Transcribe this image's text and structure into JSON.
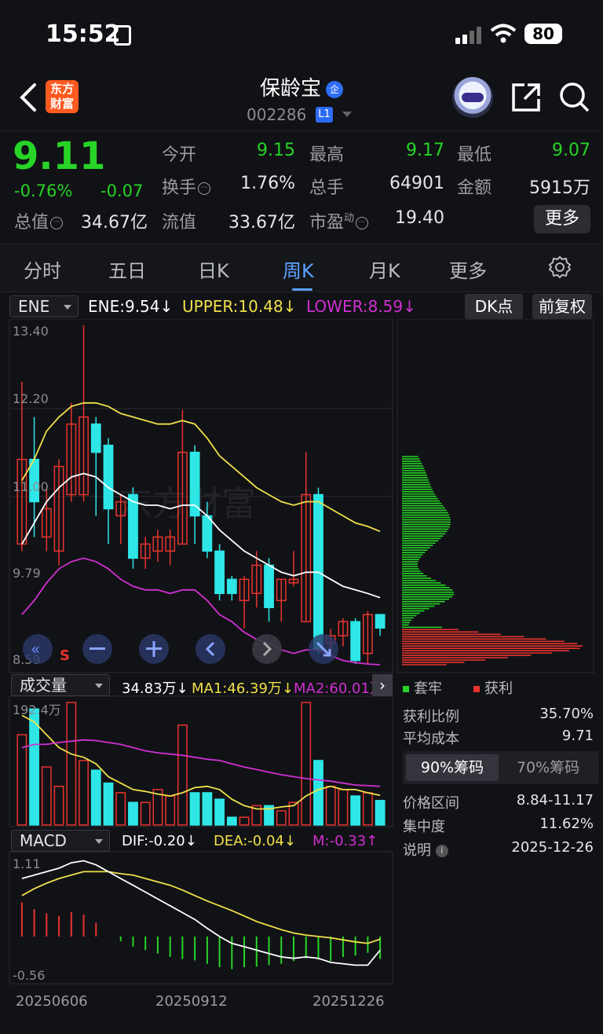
{
  "status": {
    "time": "15:52",
    "battery": "80"
  },
  "header": {
    "logo": "东方财富",
    "title": "保龄宝",
    "badge": "企",
    "code": "002286",
    "level": "L1"
  },
  "quote": {
    "price": "9.11",
    "pct": "-0.76%",
    "chg": "-0.07",
    "labels": {
      "open": "今开",
      "high": "最高",
      "low": "最低",
      "turnover": "换手",
      "volume": "总手",
      "amount": "金额",
      "mktcap": "总值",
      "float": "流值",
      "pe": "市盈",
      "pe_sup": "动"
    },
    "values": {
      "open": "9.15",
      "high": "9.17",
      "low": "9.07",
      "turnover": "1.76%",
      "volume": "64901",
      "amount": "5915万",
      "mktcap": "34.67亿",
      "float": "33.67亿",
      "pe": "19.40"
    },
    "more": "更多"
  },
  "tabs": [
    "分时",
    "五日",
    "日K",
    "周K",
    "月K",
    "更多"
  ],
  "ene": {
    "name": "ENE",
    "ene": "ENE:9.54↓",
    "upper": "UPPER:10.48↓",
    "lower": "LOWER:8.59↓",
    "dk": "DK点",
    "fq": "前复权"
  },
  "price_axis": [
    "13.40",
    "12.20",
    "11.00",
    "9.79",
    "8.59"
  ],
  "vol": {
    "name": "成交量",
    "val": "34.83万↓",
    "ma1": "MA1:46.39万↓",
    "ma2": "MA2:60.01万",
    "axis_top": "192.4万"
  },
  "macd": {
    "name": "MACD",
    "dif": "DIF:-0.20↓",
    "dea": "DEA:-0.04↓",
    "m": "M:-0.33↑",
    "axis_top": "1.11",
    "axis_bot": "-0.56"
  },
  "dates": [
    "20250606",
    "20250912",
    "20251226"
  ],
  "chips": {
    "legend_trap": "套牢",
    "legend_profit": "获利",
    "rows": [
      {
        "label": "获利比例",
        "value": "35.70%"
      },
      {
        "label": "平均成本",
        "value": "9.71"
      }
    ],
    "tab90": "90%筹码",
    "tab70": "70%筹码",
    "rows2": [
      {
        "label": "价格区间",
        "value": "8.84-11.17"
      },
      {
        "label": "集中度",
        "value": "11.62%"
      },
      {
        "label": "说明",
        "value": "2025-12-26"
      }
    ]
  },
  "colors": {
    "up": "#e8342f",
    "down": "#2ee6e6",
    "green": "#27d427",
    "ene": "#ffffff",
    "upper": "#f0e04a",
    "lower": "#d12fd1",
    "accent": "#5aa2ff"
  },
  "chart_data": {
    "type": "candlestick",
    "period": "weekly",
    "candles": [
      {
        "o": 10.3,
        "c": 11.5,
        "h": 12.6,
        "l": 10.2
      },
      {
        "o": 11.5,
        "c": 10.9,
        "h": 12.1,
        "l": 10.4
      },
      {
        "o": 10.4,
        "c": 10.8,
        "h": 11.1,
        "l": 10.2
      },
      {
        "o": 10.2,
        "c": 11.4,
        "h": 11.5,
        "l": 10.0
      },
      {
        "o": 11.0,
        "c": 12.0,
        "h": 12.3,
        "l": 10.9
      },
      {
        "o": 11.0,
        "c": 12.1,
        "h": 13.4,
        "l": 10.9
      },
      {
        "o": 12.0,
        "c": 11.6,
        "h": 12.1,
        "l": 10.7
      },
      {
        "o": 11.7,
        "c": 10.8,
        "h": 11.8,
        "l": 10.3
      },
      {
        "o": 10.7,
        "c": 10.9,
        "h": 11.0,
        "l": 10.3
      },
      {
        "o": 11.0,
        "c": 10.1,
        "h": 11.1,
        "l": 9.95
      },
      {
        "o": 10.1,
        "c": 10.3,
        "h": 10.4,
        "l": 9.95
      },
      {
        "o": 10.2,
        "c": 10.4,
        "h": 10.5,
        "l": 10.05
      },
      {
        "o": 10.2,
        "c": 10.4,
        "h": 10.5,
        "l": 10.0
      },
      {
        "o": 10.3,
        "c": 11.6,
        "h": 12.2,
        "l": 10.3
      },
      {
        "o": 11.6,
        "c": 10.7,
        "h": 11.7,
        "l": 10.3
      },
      {
        "o": 10.7,
        "c": 10.2,
        "h": 10.9,
        "l": 10.1
      },
      {
        "o": 10.2,
        "c": 9.6,
        "h": 10.3,
        "l": 9.5
      },
      {
        "o": 9.8,
        "c": 9.6,
        "h": 9.85,
        "l": 9.5
      },
      {
        "o": 9.5,
        "c": 9.8,
        "h": 9.85,
        "l": 9.1
      },
      {
        "o": 9.6,
        "c": 10.0,
        "h": 10.2,
        "l": 9.4
      },
      {
        "o": 10.0,
        "c": 9.4,
        "h": 10.1,
        "l": 9.2
      },
      {
        "o": 9.5,
        "c": 9.8,
        "h": 9.8,
        "l": 9.2
      },
      {
        "o": 9.75,
        "c": 9.8,
        "h": 10.2,
        "l": 9.7
      },
      {
        "o": 9.2,
        "c": 11.0,
        "h": 11.6,
        "l": 9.2
      },
      {
        "o": 11.0,
        "c": 8.8,
        "h": 11.1,
        "l": 8.75
      },
      {
        "o": 8.9,
        "c": 9.0,
        "h": 9.1,
        "l": 8.75
      },
      {
        "o": 9.0,
        "c": 9.2,
        "h": 9.25,
        "l": 8.85
      },
      {
        "o": 9.2,
        "c": 8.65,
        "h": 9.25,
        "l": 8.6
      },
      {
        "o": 8.75,
        "c": 9.3,
        "h": 9.35,
        "l": 8.6
      },
      {
        "o": 9.3,
        "c": 9.11,
        "h": 9.3,
        "l": 9.0
      }
    ],
    "volume": [
      140,
      180,
      90,
      60,
      190,
      100,
      85,
      65,
      50,
      35,
      35,
      55,
      45,
      155,
      50,
      50,
      40,
      12,
      12,
      30,
      30,
      22,
      35,
      190,
      100,
      60,
      55,
      45,
      50,
      38
    ],
    "ma1": [
      170,
      160,
      140,
      120,
      110,
      105,
      95,
      75,
      65,
      55,
      52,
      48,
      45,
      50,
      58,
      60,
      55,
      40,
      30,
      25,
      25,
      28,
      30,
      45,
      55,
      60,
      55,
      55,
      50,
      46
    ],
    "ma2": [
      120,
      125,
      125,
      128,
      130,
      132,
      131,
      128,
      125,
      120,
      115,
      112,
      110,
      108,
      105,
      102,
      100,
      95,
      90,
      86,
      82,
      78,
      75,
      72,
      70,
      68,
      65,
      62,
      61,
      60
    ],
    "ene": [
      10.3,
      10.6,
      10.9,
      11.1,
      11.25,
      11.3,
      11.25,
      11.1,
      11.0,
      10.9,
      10.85,
      10.85,
      10.8,
      10.85,
      10.85,
      10.7,
      10.5,
      10.35,
      10.2,
      10.1,
      10.0,
      9.9,
      9.85,
      9.9,
      9.9,
      9.8,
      9.7,
      9.65,
      9.6,
      9.54
    ],
    "upper": [
      11.2,
      11.5,
      11.9,
      12.1,
      12.25,
      12.3,
      12.3,
      12.25,
      12.15,
      12.1,
      12.05,
      12.0,
      12.0,
      12.05,
      12.0,
      11.8,
      11.55,
      11.4,
      11.25,
      11.1,
      11.0,
      10.9,
      10.85,
      10.9,
      10.9,
      10.8,
      10.7,
      10.6,
      10.55,
      10.48
    ],
    "lower": [
      9.3,
      9.5,
      9.75,
      9.95,
      10.05,
      10.1,
      10.05,
      9.95,
      9.8,
      9.7,
      9.65,
      9.65,
      9.6,
      9.65,
      9.65,
      9.5,
      9.3,
      9.2,
      9.05,
      8.95,
      8.9,
      8.8,
      8.75,
      8.8,
      8.8,
      8.72,
      8.65,
      8.62,
      8.6,
      8.59
    ],
    "dif": [
      0.85,
      0.9,
      0.95,
      1.0,
      1.08,
      1.11,
      1.05,
      0.95,
      0.85,
      0.75,
      0.65,
      0.55,
      0.45,
      0.35,
      0.25,
      0.12,
      0.0,
      -0.1,
      -0.15,
      -0.2,
      -0.25,
      -0.3,
      -0.32,
      -0.3,
      -0.32,
      -0.38,
      -0.4,
      -0.42,
      -0.42,
      -0.2
    ],
    "dea": [
      0.6,
      0.7,
      0.78,
      0.85,
      0.9,
      0.95,
      0.95,
      0.95,
      0.92,
      0.9,
      0.85,
      0.8,
      0.75,
      0.68,
      0.6,
      0.52,
      0.45,
      0.38,
      0.3,
      0.22,
      0.16,
      0.1,
      0.05,
      0.02,
      0.0,
      -0.02,
      -0.05,
      -0.08,
      -0.1,
      -0.04
    ],
    "macd": [
      0.5,
      0.4,
      0.34,
      0.3,
      0.36,
      0.32,
      0.2,
      0.0,
      -0.07,
      -0.15,
      -0.2,
      -0.25,
      -0.3,
      -0.33,
      -0.35,
      -0.4,
      -0.45,
      -0.48,
      -0.45,
      -0.44,
      -0.42,
      -0.4,
      -0.36,
      -0.32,
      -0.34,
      -0.36,
      -0.3,
      -0.28,
      -0.24,
      -0.33
    ],
    "price_range": [
      8.59,
      13.4
    ]
  }
}
